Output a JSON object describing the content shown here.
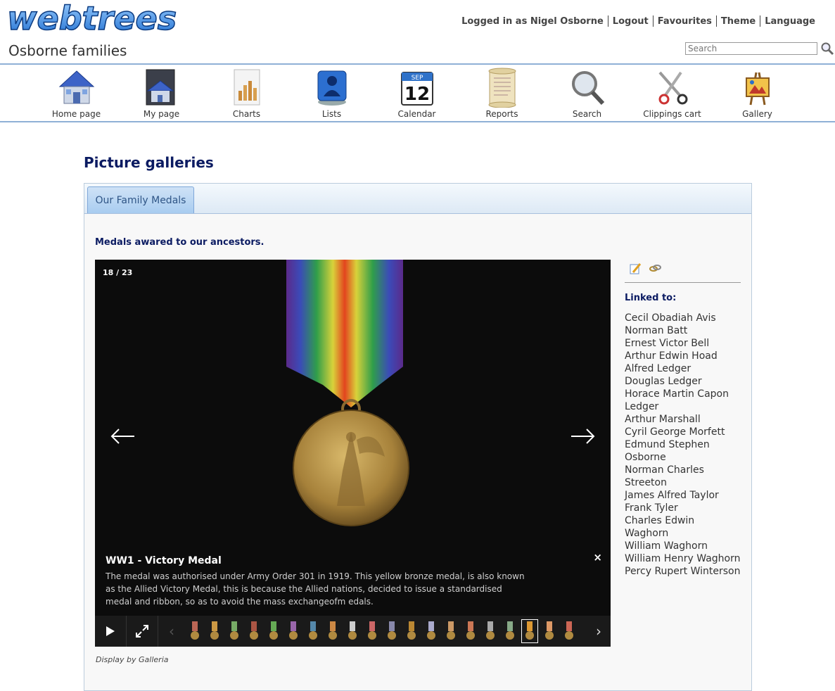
{
  "logo_text": "webtrees",
  "site_title": "Osborne families",
  "topnav": {
    "logged_in": "Logged in as Nigel Osborne",
    "logout": "Logout",
    "favourites": "Favourites",
    "theme": "Theme",
    "language": "Language"
  },
  "search": {
    "placeholder": "Search",
    "icon": "magnifier-icon"
  },
  "menu": [
    {
      "label": "Home page",
      "icon": "house-icon"
    },
    {
      "label": "My page",
      "icon": "my-house-icon"
    },
    {
      "label": "Charts",
      "icon": "bar-chart-icon"
    },
    {
      "label": "Lists",
      "icon": "people-list-icon"
    },
    {
      "label": "Calendar",
      "icon": "calendar-icon",
      "calendar_month": "SEP",
      "calendar_day": "12"
    },
    {
      "label": "Reports",
      "icon": "scroll-icon"
    },
    {
      "label": "Search",
      "icon": "magnifying-glass-icon"
    },
    {
      "label": "Clippings cart",
      "icon": "scissors-icon"
    },
    {
      "label": "Gallery",
      "icon": "easel-icon"
    }
  ],
  "page_heading": "Picture galleries",
  "tab_label": "Our Family Medals",
  "gallery_description": "Medals awared to our ancestors.",
  "viewer": {
    "counter": "18 / 23",
    "caption_title": "WW1 - Victory Medal",
    "caption_text": "The medal was authorised under Army Order 301 in 1919. This yellow bronze medal, is also known as the Allied Victory Medal, this is because the Allied nations, decided to issue a standardised medal and ribbon, so as to avoid the mass exchangeofm edals.",
    "close": "×",
    "thumbnail_count": 20,
    "selected_thumbnail": 18,
    "colors": {
      "background": "#0c0c0c",
      "strip": "#1a1a1a"
    }
  },
  "credit": "Display by Galleria",
  "sidebar": {
    "linked_heading": "Linked to:",
    "people": [
      "Cecil Obadiah Avis",
      "Norman Batt",
      "Ernest Victor Bell",
      "Arthur Edwin Hoad",
      "Alfred Ledger",
      "Douglas Ledger",
      "Horace Martin Capon",
      "Ledger",
      "Arthur Marshall",
      "Cyril George Morfett",
      "Edmund Stephen",
      "Osborne",
      "Norman Charles Streeton",
      "James Alfred Taylor",
      "Frank Tyler",
      "Charles Edwin Waghorn",
      "William Waghorn",
      "William Henry Waghorn",
      "Percy Rupert Winterson"
    ]
  },
  "colors": {
    "heading": "#0b1b62",
    "rule": "#8fb0d6",
    "tab_fill": "#a8ccf0",
    "tab_text": "#2f5586"
  }
}
